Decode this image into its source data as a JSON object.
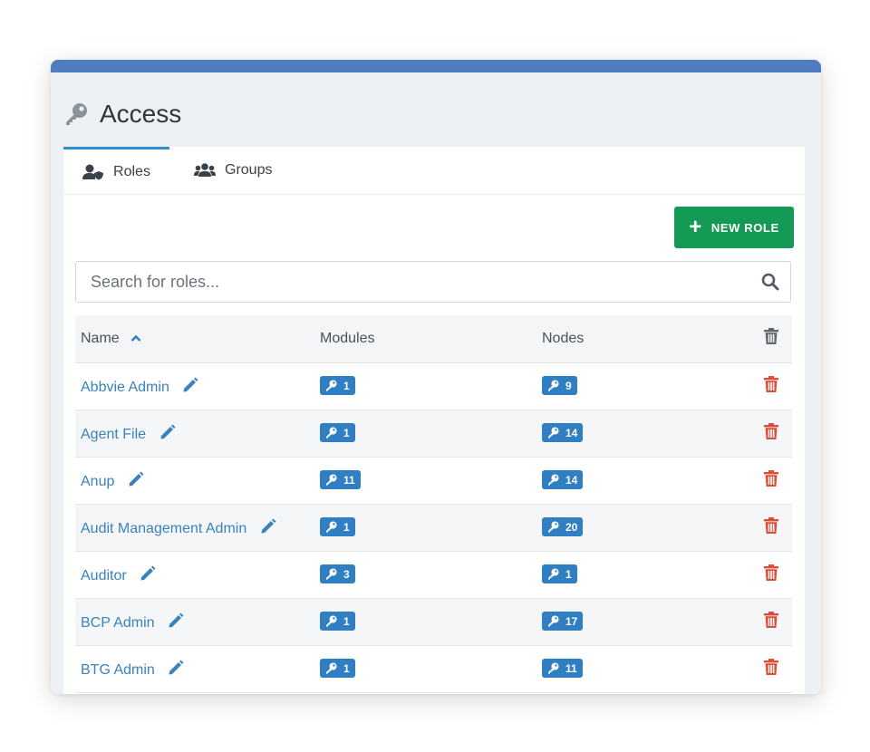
{
  "page": {
    "title": "Access"
  },
  "tabs": [
    {
      "label": "Roles",
      "active": true
    },
    {
      "label": "Groups",
      "active": false
    }
  ],
  "actions": {
    "new_role_label": "NEW ROLE"
  },
  "search": {
    "placeholder": "Search for roles...",
    "value": ""
  },
  "table": {
    "columns": {
      "name": "Name",
      "modules": "Modules",
      "nodes": "Nodes"
    },
    "sort": {
      "column": "name",
      "direction": "ascending"
    },
    "rows": [
      {
        "name": "Abbvie Admin",
        "modules": "1",
        "nodes": "9"
      },
      {
        "name": "Agent File",
        "modules": "1",
        "nodes": "14"
      },
      {
        "name": "Anup",
        "modules": "11",
        "nodes": "14"
      },
      {
        "name": "Audit Management Admin",
        "modules": "1",
        "nodes": "20"
      },
      {
        "name": "Auditor",
        "modules": "3",
        "nodes": "1"
      },
      {
        "name": "BCP Admin",
        "modules": "1",
        "nodes": "17"
      },
      {
        "name": "BTG Admin",
        "modules": "1",
        "nodes": "11"
      }
    ]
  },
  "colors": {
    "accent": "#4f7dc0",
    "tab_active": "#2f8fd0",
    "link": "#3a82b9",
    "badge": "#2f7fc2",
    "new_role_button": "#149a55",
    "delete_icon": "#dd4b39",
    "header_delete_icon": "#5f666d"
  },
  "icons": {
    "header": "key-icon",
    "tab_roles": "user-shield-icon",
    "tab_groups": "users-icon",
    "new_role": "plus-icon",
    "search": "search-icon",
    "edit": "pencil-icon",
    "badge": "key-icon",
    "delete": "trash-icon",
    "sort": "chevron-up-icon"
  }
}
